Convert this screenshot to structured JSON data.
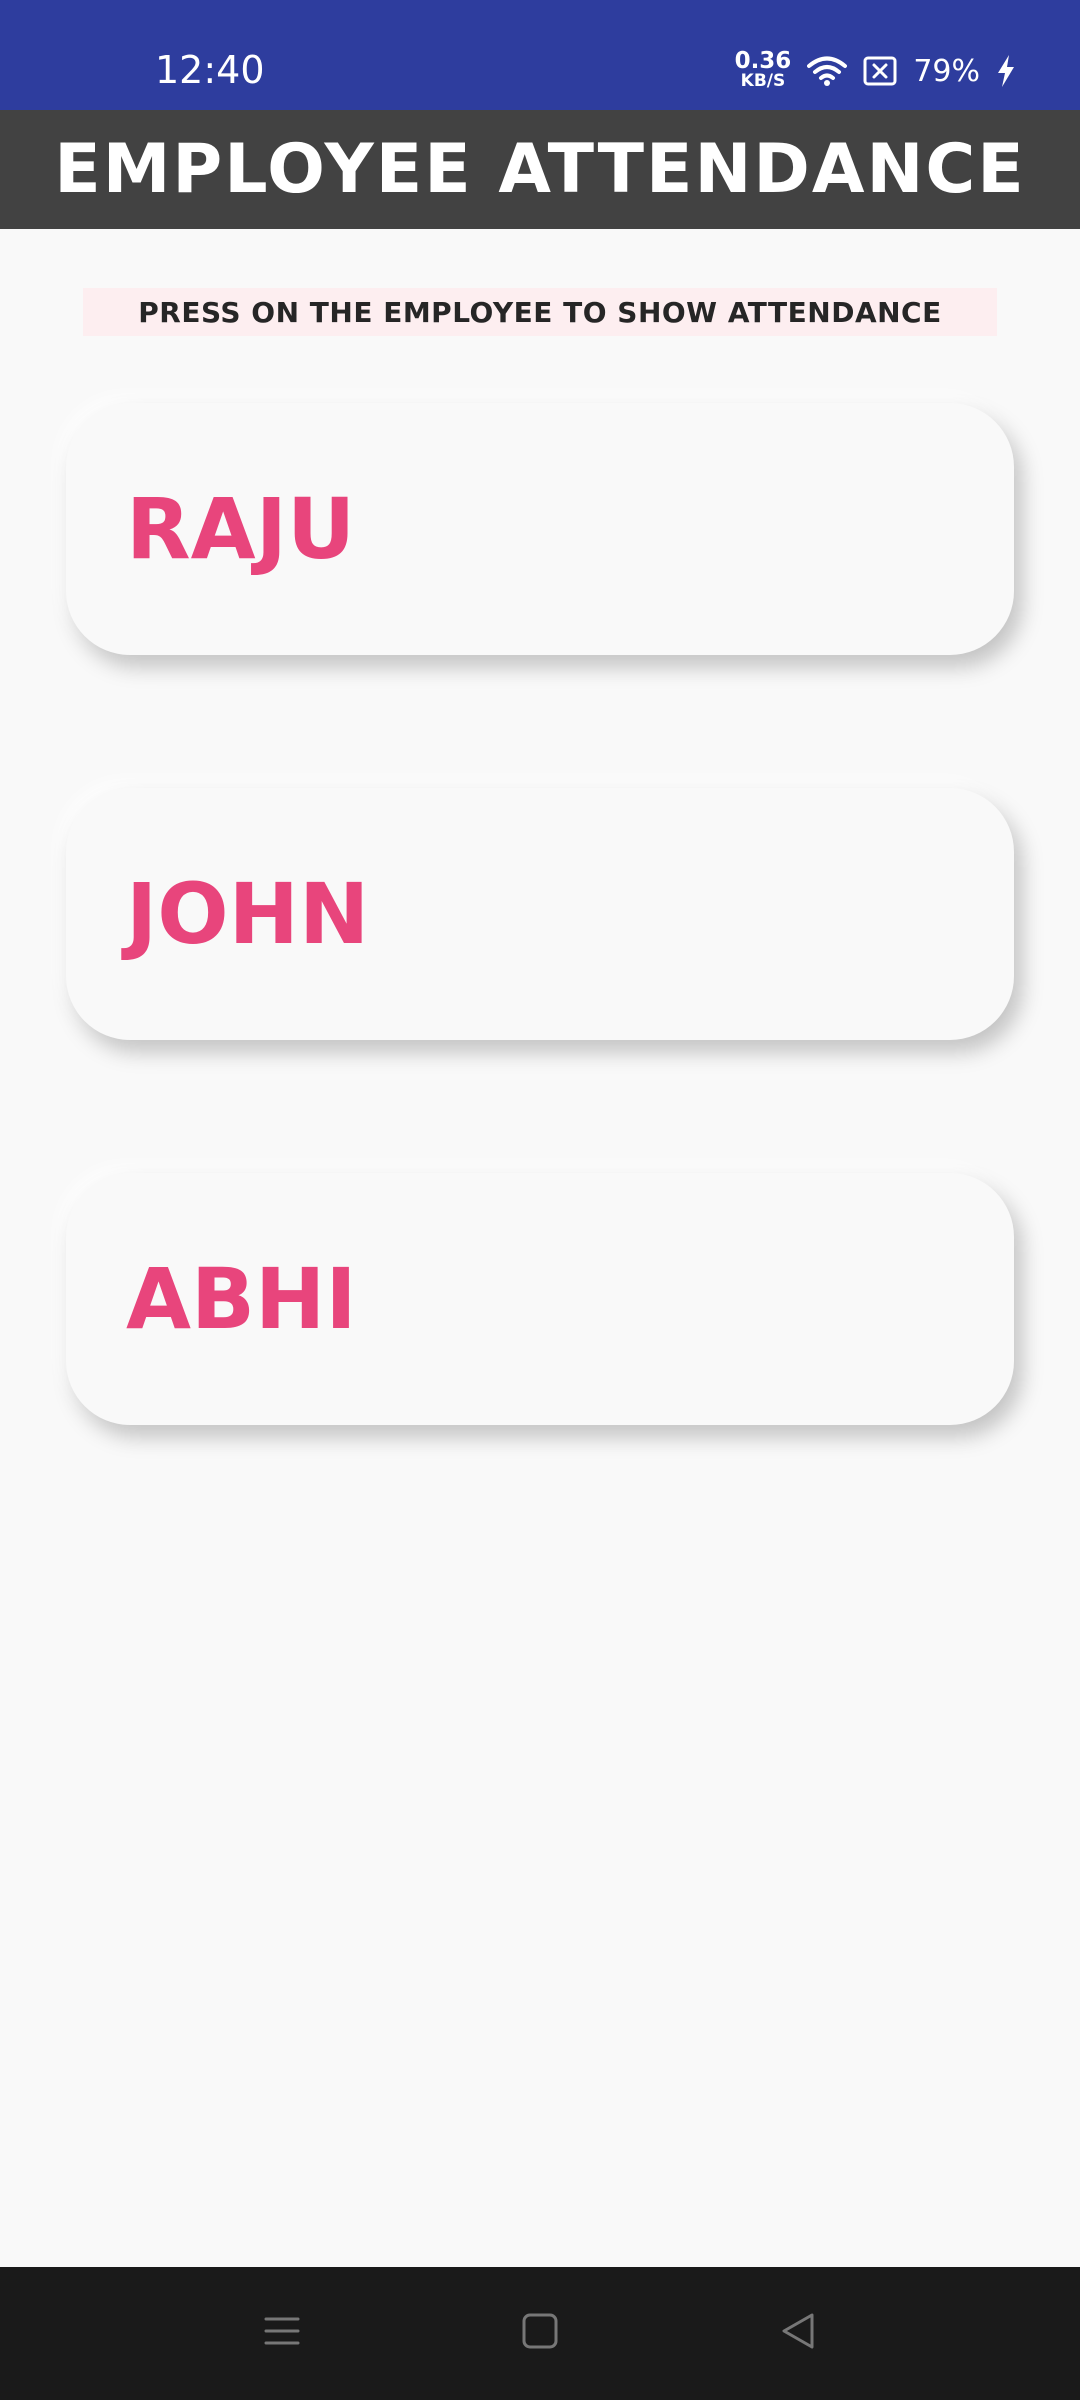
{
  "status_bar": {
    "time": "12:40",
    "net_speed_value": "0.36",
    "net_speed_unit": "KB/S",
    "battery": "79%",
    "icons": [
      "wifi-icon",
      "sim-off-icon",
      "charging-icon"
    ]
  },
  "app_bar": {
    "title": "EMPLOYEE ATTENDANCE"
  },
  "instruction": {
    "text": "PRESS ON THE EMPLOYEE TO SHOW ATTENDANCE"
  },
  "employees": [
    {
      "name": "RAJU"
    },
    {
      "name": "JOHN"
    },
    {
      "name": "ABHI"
    }
  ],
  "nav_bar": {
    "icons": [
      "menu-icon",
      "home-icon",
      "back-icon"
    ]
  },
  "colors": {
    "status_bar": "#2e3d9e",
    "app_bar": "#424242",
    "accent_name": "#e8457c",
    "banner_bg": "#fdeef0",
    "background": "#f9f9f9",
    "nav_bar": "#1a1a1a"
  }
}
